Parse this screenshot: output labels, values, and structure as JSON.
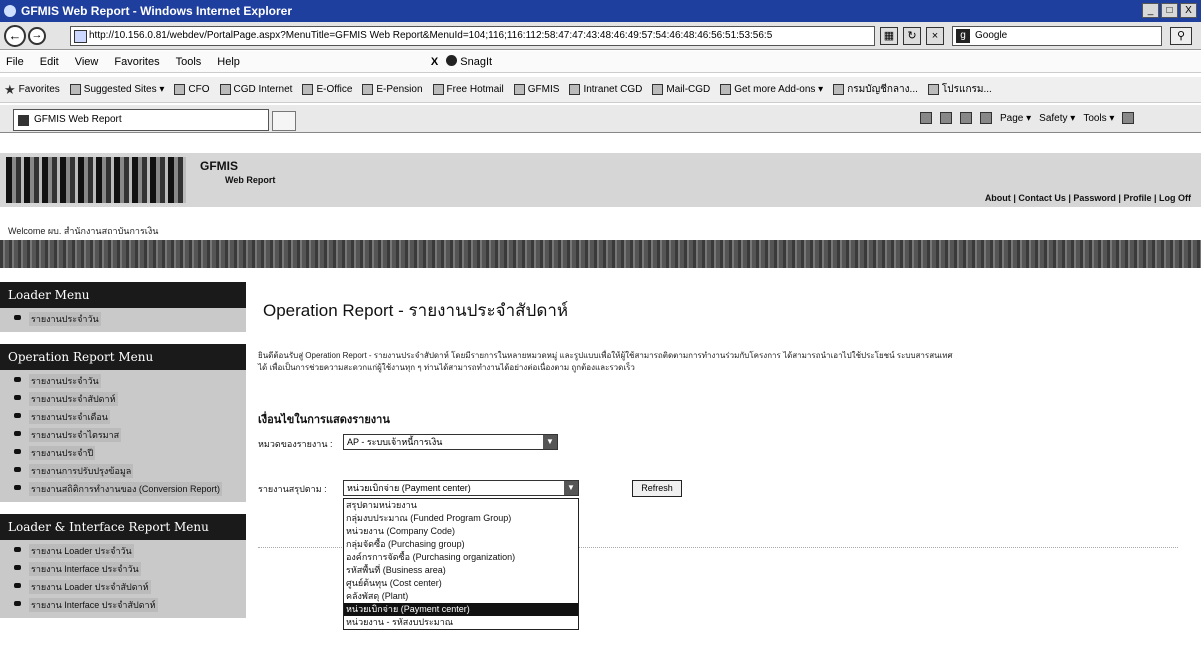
{
  "window": {
    "title": "GFMIS Web Report - Windows Internet Explorer",
    "buttons": [
      "_",
      "□",
      "X"
    ]
  },
  "address": {
    "url": "http://10.156.0.81/webdev/PortalPage.aspx?MenuTitle=GFMIS Web Report&MenuId=104;116;116:112:58:47:47:43:48:46:49:57:54:46:48:46:56:51:53:56:5",
    "search_placeholder": "Google"
  },
  "menu": {
    "items": [
      "File",
      "Edit",
      "View",
      "Favorites",
      "Tools",
      "Help"
    ],
    "close": "X",
    "snagit": "SnagIt"
  },
  "favorites": {
    "label": "Favorites",
    "items": [
      "Suggested Sites ▾",
      "CFO",
      "CGD Internet",
      "E-Office",
      "E-Pension",
      "Free Hotmail",
      "GFMIS",
      "Intranet CGD",
      "Mail-CGD",
      "Get more Add-ons ▾",
      "กรมบัญชีกลาง...",
      "โปรแกรม..."
    ]
  },
  "tab": {
    "label": "GFMIS Web Report"
  },
  "commandbar": {
    "page": "Page ▾",
    "safety": "Safety ▾",
    "tools": "Tools ▾"
  },
  "header": {
    "brand": "GFMIS",
    "brand_sub": "Web Report",
    "links": [
      "About",
      "Contact Us",
      "Password",
      "Profile",
      "Log Off"
    ],
    "welcome": "Welcome  ผบ. สำนักงานสถาบันการเงิน"
  },
  "sidebar": {
    "sections": [
      {
        "title": "Loader Menu",
        "items": [
          "รายงานประจำวัน"
        ]
      },
      {
        "title": "Operation Report Menu",
        "items": [
          "รายงานประจำวัน",
          "รายงานประจำสัปดาห์",
          "รายงานประจำเดือน",
          "รายงานประจำไตรมาส",
          "รายงานประจำปี",
          "รายงานการปรับปรุงข้อมูล",
          "รายงานสถิติการทำงานของ (Conversion Report)"
        ]
      },
      {
        "title": "Loader & Interface Report Menu",
        "items": [
          "รายงาน Loader ประจำวัน",
          "รายงาน Interface ประจำวัน",
          "รายงาน Loader ประจำสัปดาห์",
          "รายงาน Interface ประจำสัปดาห์"
        ]
      }
    ]
  },
  "main": {
    "title": "Operation Report - รายงานประจำสัปดาห์",
    "description_1": "ยินดีต้อนรับสู่ Operation Report - รายงานประจำสัปดาห์ โดยมีรายการในหลายหมวดหมู่ และรูปแบบเพื่อให้ผู้ใช้สามารถติดตามการทำงานร่วมกับโครงการ ได้สามารถนำเอาไปใช้ประโยชน์ ระบบสารสนเทศ",
    "description_2": "ได้ เพื่อเป็นการช่วยความสะดวกแก่ผู้ใช้งานทุก ๆ ท่านได้สามารถทำงานได้อย่างต่อเนื่องตาม ถูกต้องและรวดเร็ว",
    "section_heading": "เงื่อนไขในการแสดงรายงาน",
    "field1_label": "หมวดของรายงาน   :",
    "field1_value": "AP - ระบบเจ้าหนี้การเงิน",
    "field2_label": "รายงานสรุปตาม   :",
    "field2_value": "หน่วยเบิกจ่าย (Payment center)",
    "refresh_label": "Refresh",
    "options": [
      "สรุปตามหน่วยงาน",
      "กลุ่มงบประมาณ (Funded Program Group)",
      "หน่วยงาน (Company Code)",
      "กลุ่มจัดซื้อ (Purchasing group)",
      "องค์กรการจัดซื้อ (Purchasing organization)",
      "รหัสพื้นที่ (Business area)",
      "ศูนย์ต้นทุน (Cost center)",
      "คลังพัสดุ (Plant)",
      "หน่วยเบิกจ่าย (Payment center)",
      "หน่วยงาน - รหัสงบประมาณ"
    ],
    "selected_index": 8
  }
}
